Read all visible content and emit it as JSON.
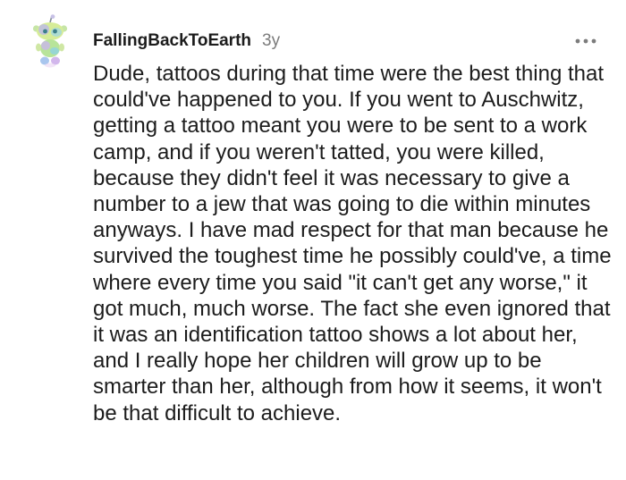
{
  "comment": {
    "username": "FallingBackToEarth",
    "age": "3y",
    "avatar_icon": "snoo-avatar-icon",
    "more_icon": "more-options-icon",
    "body": "Dude, tattoos during that time were the best thing that could've happened to you. If you went to Auschwitz, getting a tattoo meant you were to be sent to a work camp, and if you weren't tatted, you were killed, because they didn't feel it was necessary to give a number to a jew that was going to die within minutes anyways. I have mad respect for that man because he survived the toughest time he possibly could've, a time where every time you said \"it can't get any worse,\" it got much, much worse. The fact she even ignored that it was an identification tattoo shows a lot about her, and I really hope her children will grow up to be smarter than her, although from how it seems, it won't be that difficult to achieve."
  }
}
